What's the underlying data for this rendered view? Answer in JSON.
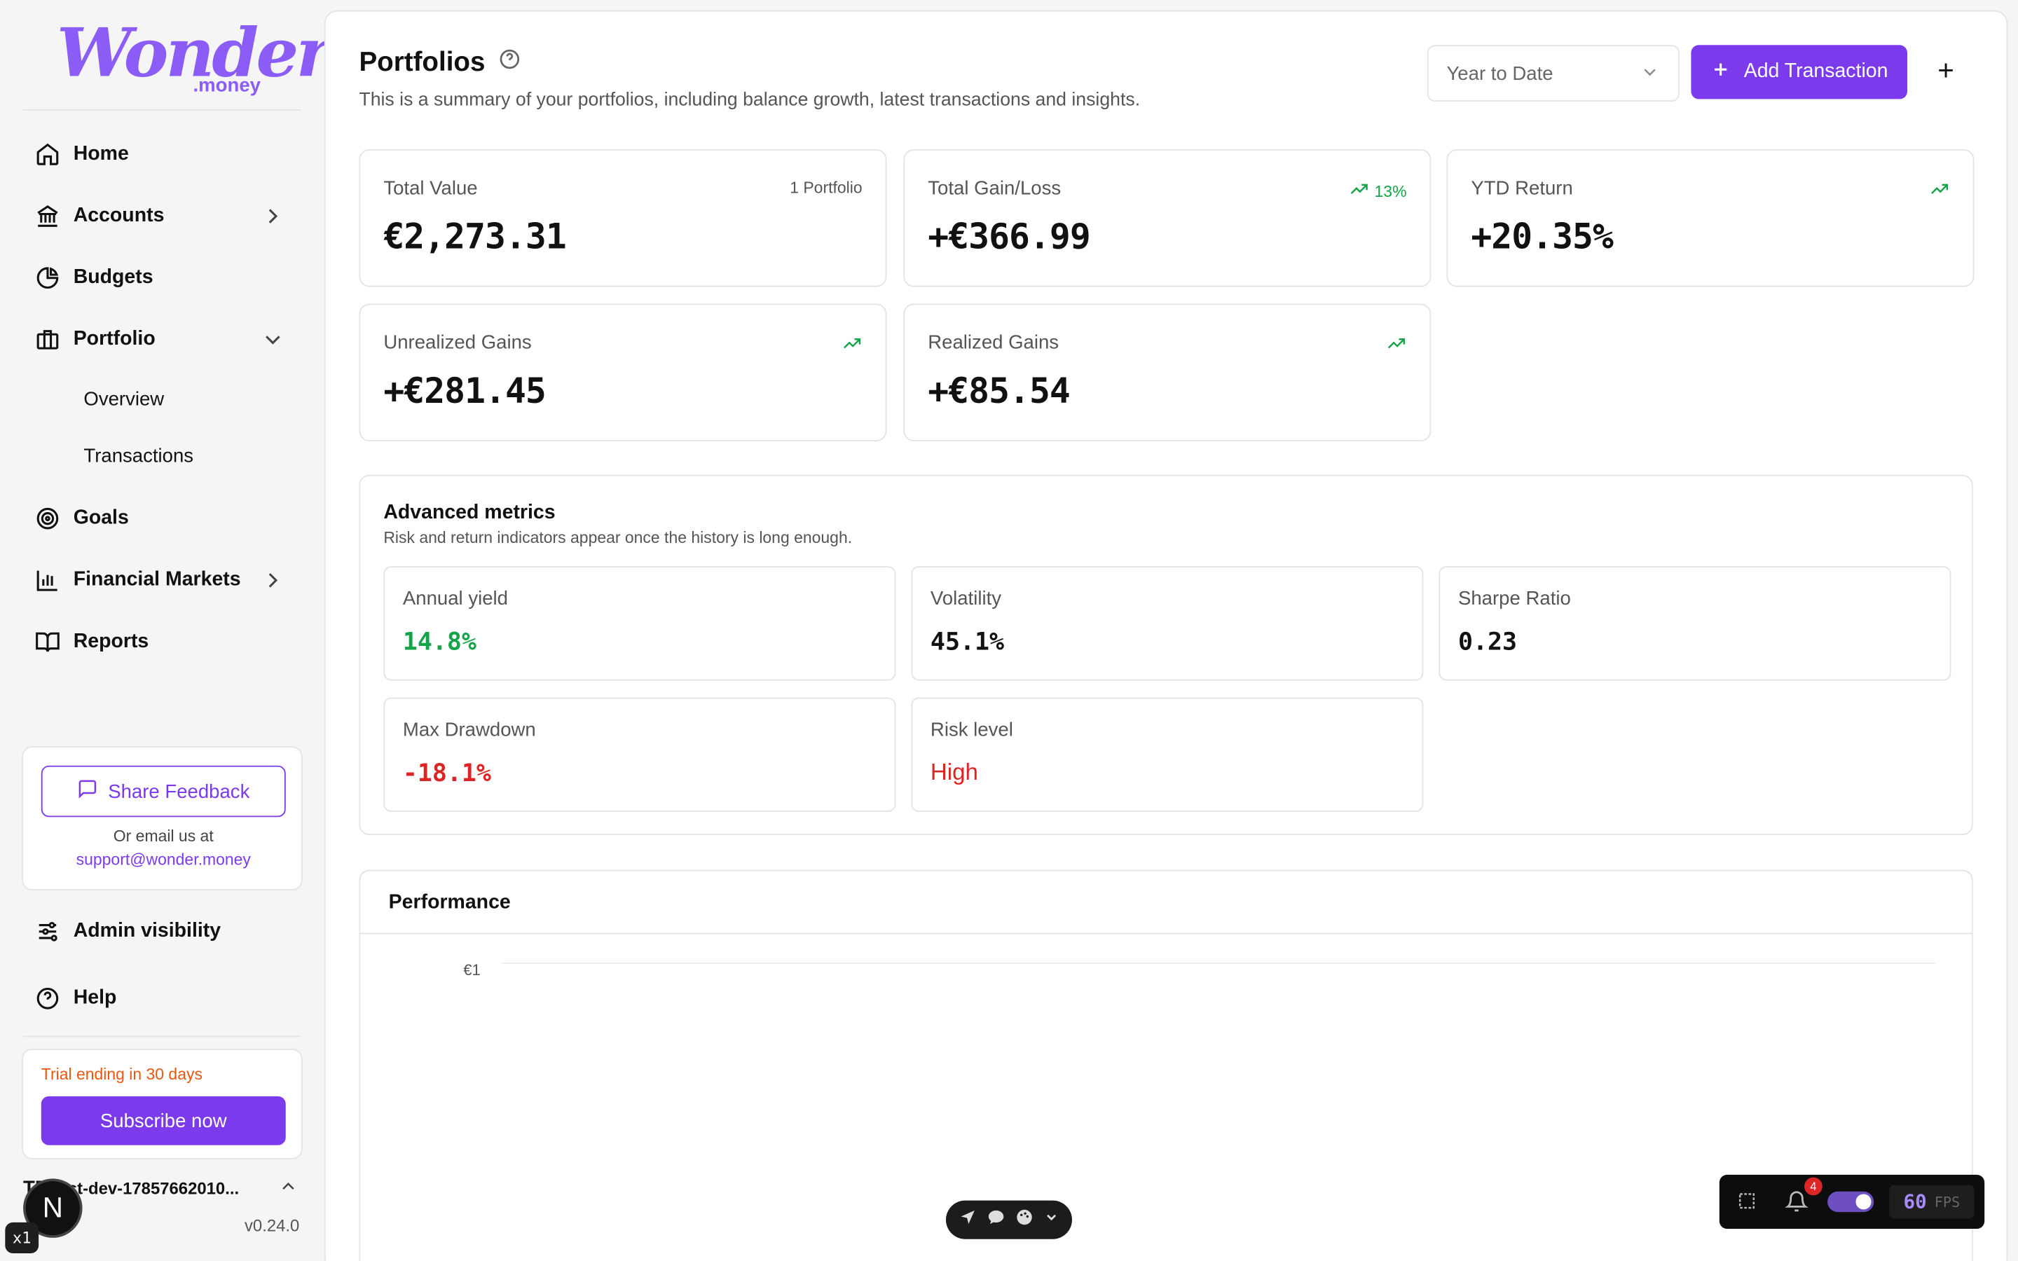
{
  "brand": {
    "name": "Wonder",
    "suffix": ".money"
  },
  "sidebar": {
    "items": [
      {
        "label": "Home",
        "icon": "home-icon"
      },
      {
        "label": "Accounts",
        "icon": "bank-icon"
      },
      {
        "label": "Budgets",
        "icon": "pie-chart-icon"
      },
      {
        "label": "Portfolio",
        "icon": "briefcase-icon"
      },
      {
        "label": "Goals",
        "icon": "target-icon"
      },
      {
        "label": "Financial Markets",
        "icon": "bar-chart-icon"
      },
      {
        "label": "Reports",
        "icon": "book-icon"
      }
    ],
    "portfolio_sub": [
      "Overview",
      "Transactions"
    ],
    "feedback": {
      "button": "Share Feedback",
      "note": "Or email us at",
      "email": "support@wonder.money"
    },
    "bottom_items": [
      {
        "label": "Admin visibility",
        "icon": "sliders-icon"
      },
      {
        "label": "Help",
        "icon": "help-circle-icon"
      }
    ],
    "trial": {
      "text": "Trial ending in 30 days",
      "button": "Subscribe now"
    },
    "user": {
      "initials": "TE",
      "name": "test-dev-17857662010..."
    },
    "version": "v0.24.0"
  },
  "header": {
    "title": "Portfolios",
    "subtitle": "This is a summary of your portfolios, including balance growth, latest transactions and insights.",
    "period": "Year to Date",
    "add_button": "Add Transaction",
    "plus": "+"
  },
  "stats": [
    {
      "label": "Total Value",
      "value": "€2,273.31",
      "meta": "1 Portfolio"
    },
    {
      "label": "Total Gain/Loss",
      "value": "+€366.99",
      "meta": "13%"
    },
    {
      "label": "YTD Return",
      "value": "+20.35%",
      "meta": ""
    },
    {
      "label": "Unrealized Gains",
      "value": "+€281.45",
      "meta": ""
    },
    {
      "label": "Realized Gains",
      "value": "+€85.54",
      "meta": ""
    }
  ],
  "advanced": {
    "title": "Advanced metrics",
    "subtitle": "Risk and return indicators appear once the history is long enough.",
    "metrics": [
      {
        "label": "Annual yield",
        "value": "14.8%"
      },
      {
        "label": "Volatility",
        "value": "45.1%"
      },
      {
        "label": "Sharpe Ratio",
        "value": "0.23"
      },
      {
        "label": "Max Drawdown",
        "value": "-18.1%"
      },
      {
        "label": "Risk level",
        "value": "High"
      }
    ]
  },
  "performance": {
    "title": "Performance",
    "tick": "€1"
  },
  "devtools": {
    "notifications": "4",
    "fps": "60",
    "fps_label": "FPS",
    "n_badge": "N",
    "zoom": "x1"
  },
  "colors": {
    "accent": "#7c3aed",
    "positive": "#16a34a",
    "negative": "#dc2626",
    "warning": "#ea580c"
  }
}
